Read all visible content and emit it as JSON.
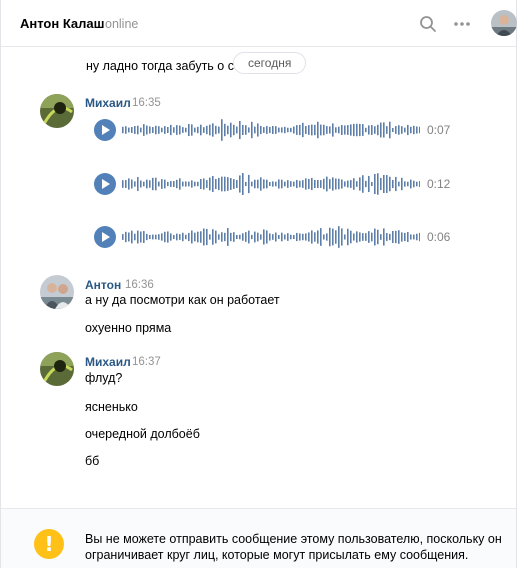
{
  "header": {
    "contact_name": "Антон Калаш",
    "status": "online"
  },
  "date_separator": "сегодня",
  "messages": [
    {
      "text": "ну ладно тогда забуть о серваке"
    },
    {
      "sender": "Михаил",
      "time": "16:35",
      "voice": [
        {
          "duration": "0:07"
        },
        {
          "duration": "0:12"
        },
        {
          "duration": "0:06"
        }
      ]
    },
    {
      "sender": "Антон",
      "time": "16:36",
      "lines": [
        "а ну да посмотри как он работает",
        "охуенно пряма"
      ]
    },
    {
      "sender": "Михаил",
      "time": "16:37",
      "lines": [
        "флуд?",
        "ясненько",
        "очередной долбоёб",
        "бб"
      ]
    }
  ],
  "footer": {
    "icon": "exclamation-icon",
    "notice_line1": "Вы не можете отправить сообщение этому пользователю, поскольку он",
    "notice_line2": "ограничивает круг лиц, которые могут присылать ему сообщения.",
    "icon_color": "#ffc018"
  },
  "colors": {
    "accent": "#5181b8",
    "sender": "#2a5885",
    "muted": "#939393"
  }
}
